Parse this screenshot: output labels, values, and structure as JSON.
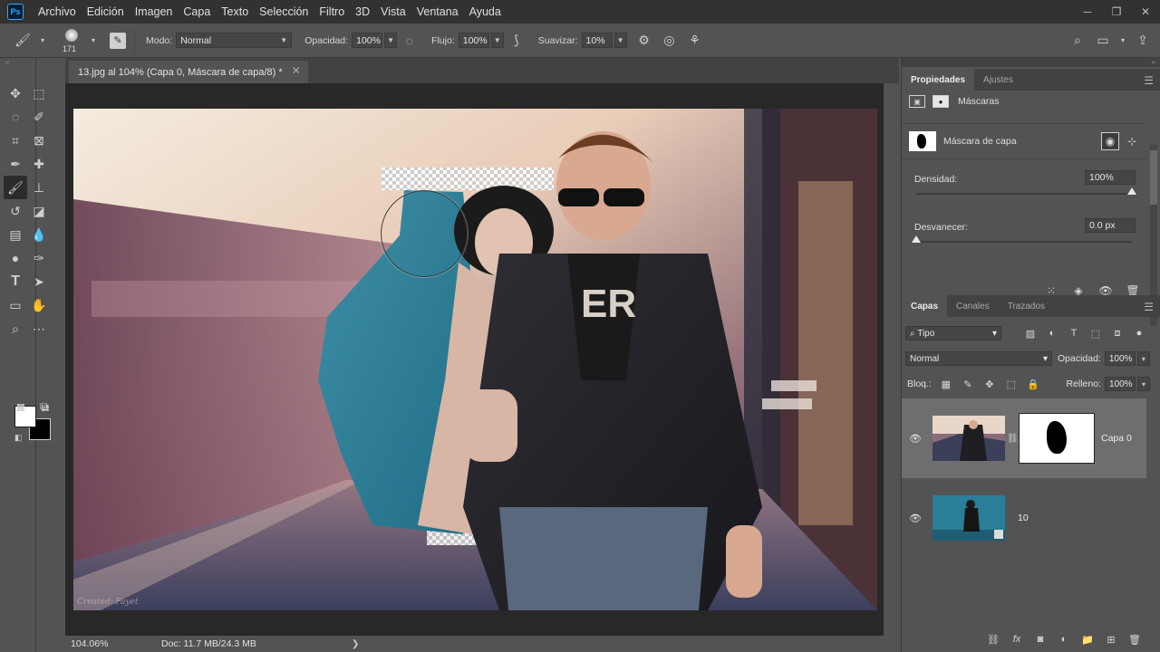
{
  "app": {
    "logo": "Ps"
  },
  "menu": [
    "Archivo",
    "Edición",
    "Imagen",
    "Capa",
    "Texto",
    "Selección",
    "Filtro",
    "3D",
    "Vista",
    "Ventana",
    "Ayuda"
  ],
  "options": {
    "brush_size": "171",
    "mode_label": "Modo:",
    "mode_value": "Normal",
    "opacity_label": "Opacidad:",
    "opacity_value": "100%",
    "flow_label": "Flujo:",
    "flow_value": "100%",
    "smoothing_label": "Suavizar:",
    "smoothing_value": "10%"
  },
  "document": {
    "tab_title": "13.jpg al 104% (Capa 0, Máscara de capa/8) *",
    "watermark": "Created: Fayet"
  },
  "status": {
    "zoom": "104.06%",
    "doc_info": "Doc: 11.7 MB/24.3 MB",
    "arrow": "❯"
  },
  "properties": {
    "tabs": [
      "Propiedades",
      "Ajustes"
    ],
    "section_label": "Máscaras",
    "mask_label": "Máscara de capa",
    "density_label": "Densidad:",
    "density_value": "100%",
    "density_level": 1.0,
    "feather_label": "Desvanecer:",
    "feather_value": "0.0 px",
    "feather_level": 0.0
  },
  "layers_panel": {
    "tabs": [
      "Capas",
      "Canales",
      "Trazados"
    ],
    "filter_kind": "Tipo",
    "blend_mode": "Normal",
    "opacity_label": "Opacidad:",
    "opacity_value": "100%",
    "lock_label": "Bloq.:",
    "fill_label": "Relleno:",
    "fill_value": "100%",
    "layers": [
      {
        "name": "Capa 0",
        "selected": true,
        "has_mask": true
      },
      {
        "name": "10",
        "selected": false,
        "has_mask": false
      }
    ]
  },
  "colors": {
    "accent": "#31a8ff",
    "foreground": "#ffffff",
    "background": "#000000"
  }
}
